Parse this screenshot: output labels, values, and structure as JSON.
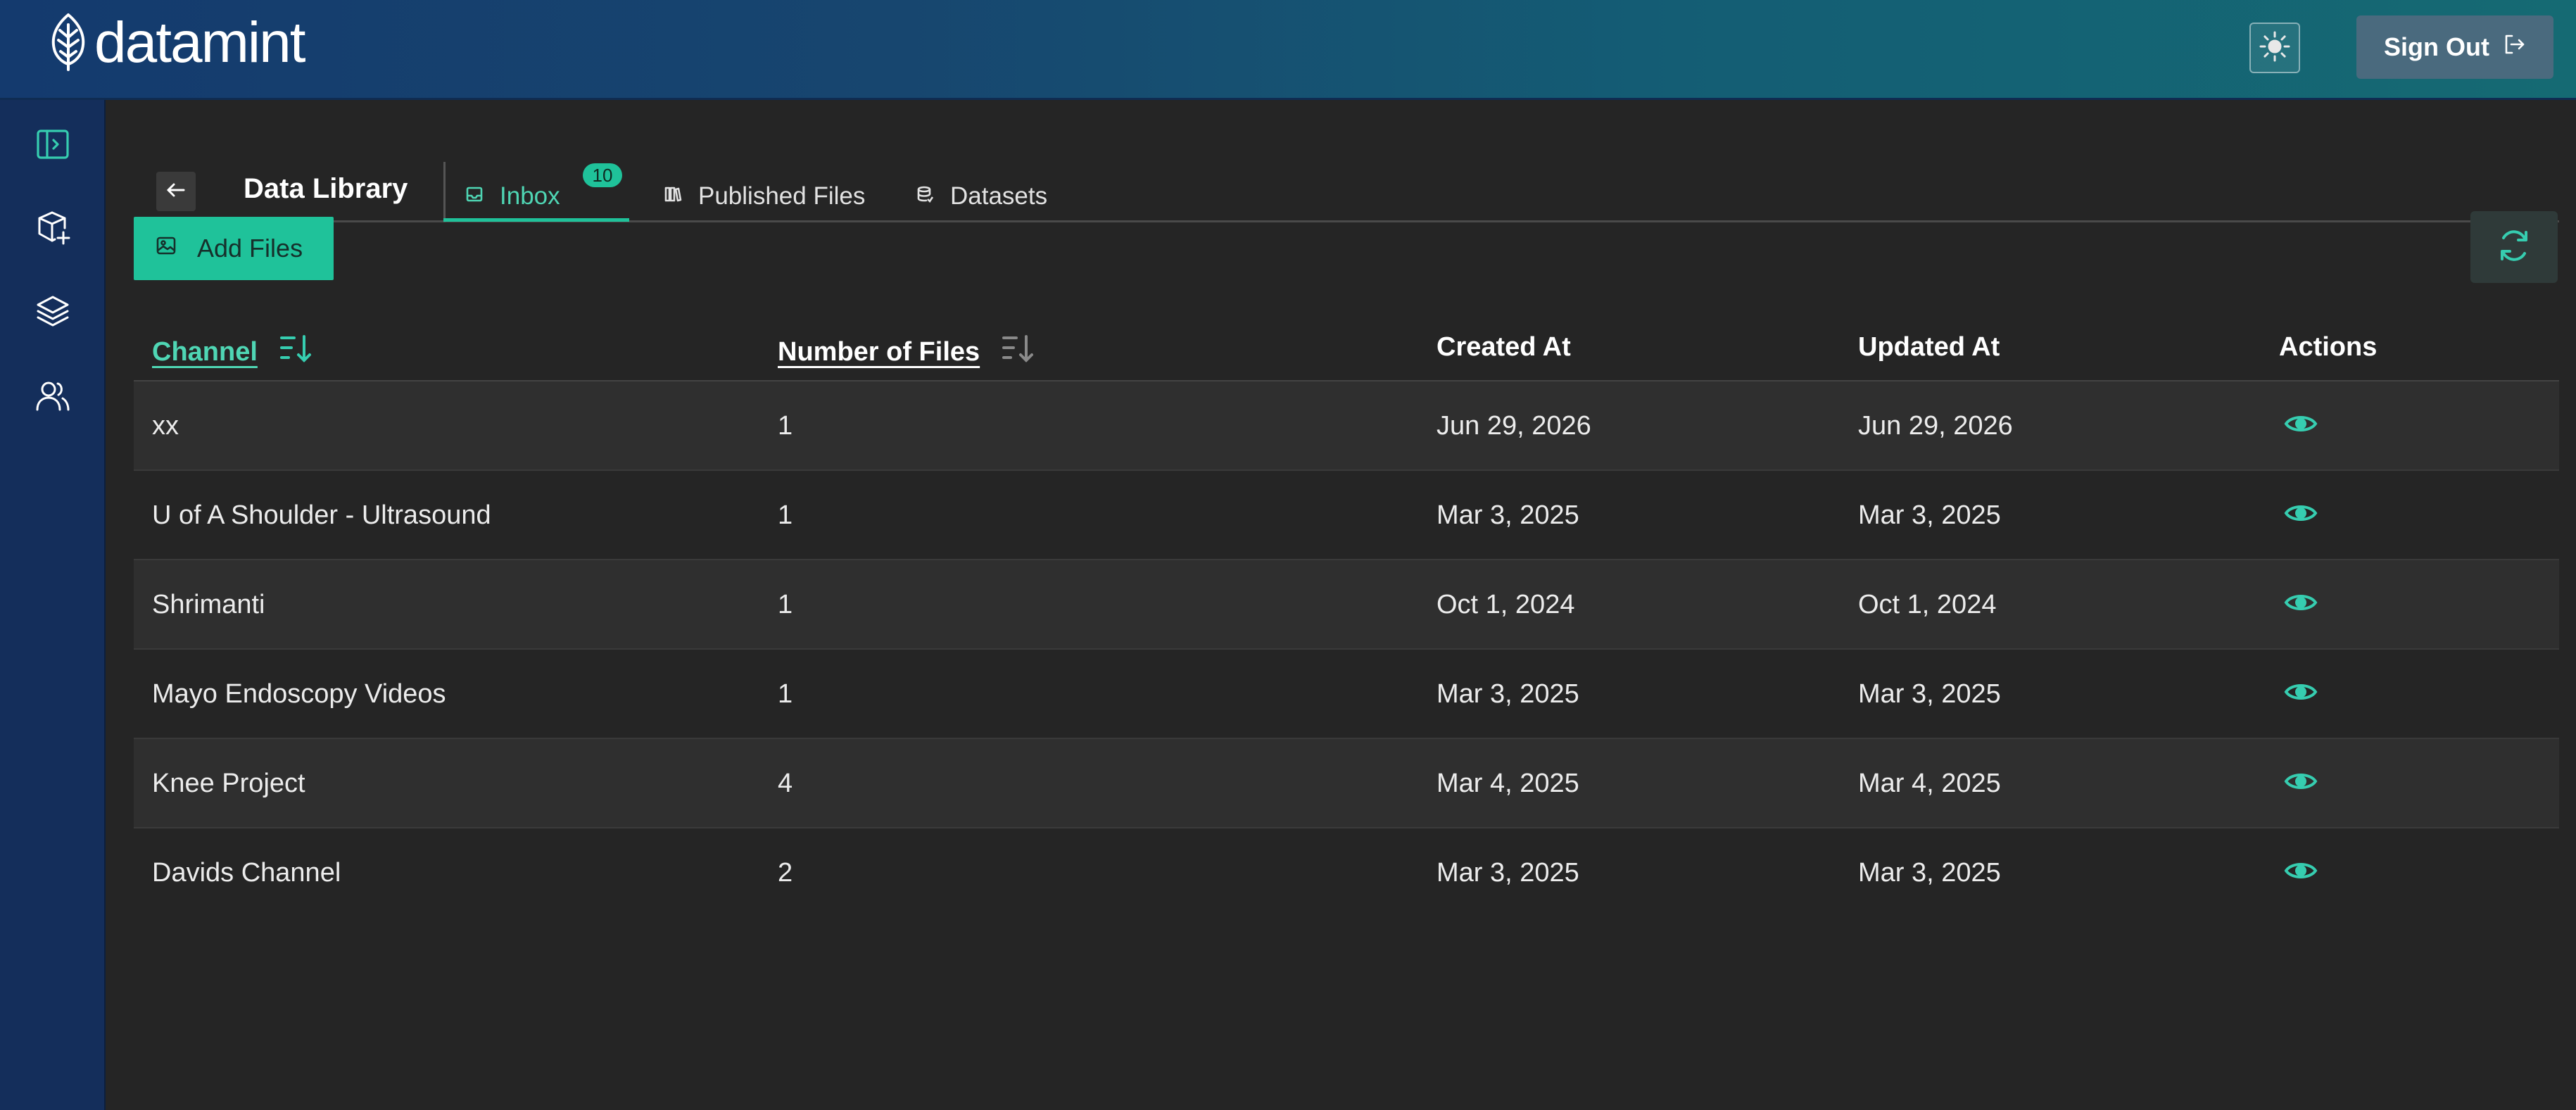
{
  "app": {
    "logo_text": "datamint"
  },
  "header": {
    "sign_out_label": "Sign Out"
  },
  "page": {
    "title": "Data Library",
    "tabs": [
      {
        "label": "Inbox",
        "badge": "10",
        "active": true
      },
      {
        "label": "Published Files",
        "active": false
      },
      {
        "label": "Datasets",
        "active": false
      }
    ],
    "add_files_label": "Add Files"
  },
  "table": {
    "columns": [
      "Channel",
      "Number of Files",
      "Created At",
      "Updated At",
      "Actions"
    ],
    "rows": [
      {
        "channel": "xx",
        "files": "1",
        "created": "Jun 29, 2026",
        "updated": "Jun 29, 2026"
      },
      {
        "channel": "U of A Shoulder - Ultrasound",
        "files": "1",
        "created": "Mar 3, 2025",
        "updated": "Mar 3, 2025"
      },
      {
        "channel": "Shrimanti",
        "files": "1",
        "created": "Oct 1, 2024",
        "updated": "Oct 1, 2024"
      },
      {
        "channel": "Mayo Endoscopy Videos",
        "files": "1",
        "created": "Mar 3, 2025",
        "updated": "Mar 3, 2025"
      },
      {
        "channel": "Knee Project",
        "files": "4",
        "created": "Mar 4, 2025",
        "updated": "Mar 4, 2025"
      },
      {
        "channel": "Davids Channel",
        "files": "2",
        "created": "Mar 3, 2025",
        "updated": "Mar 3, 2025"
      }
    ]
  },
  "icons": {
    "logo": "leaf-icon",
    "theme": "sun-icon",
    "sign_out": "sign-out-icon",
    "sidebar": [
      "sidebar-toggle-icon",
      "add-box-icon",
      "layers-icon",
      "users-icon"
    ],
    "back": "arrow-left-icon",
    "inbox": "inbox-icon",
    "published": "books-icon",
    "datasets": "database-icon",
    "add_files": "image-icon",
    "refresh": "refresh-icon",
    "sort": "sort-desc-icon",
    "view": "eye-icon"
  },
  "colors": {
    "accent": "#1fc29a",
    "sidebar": "#142e5b",
    "background": "#252525"
  }
}
